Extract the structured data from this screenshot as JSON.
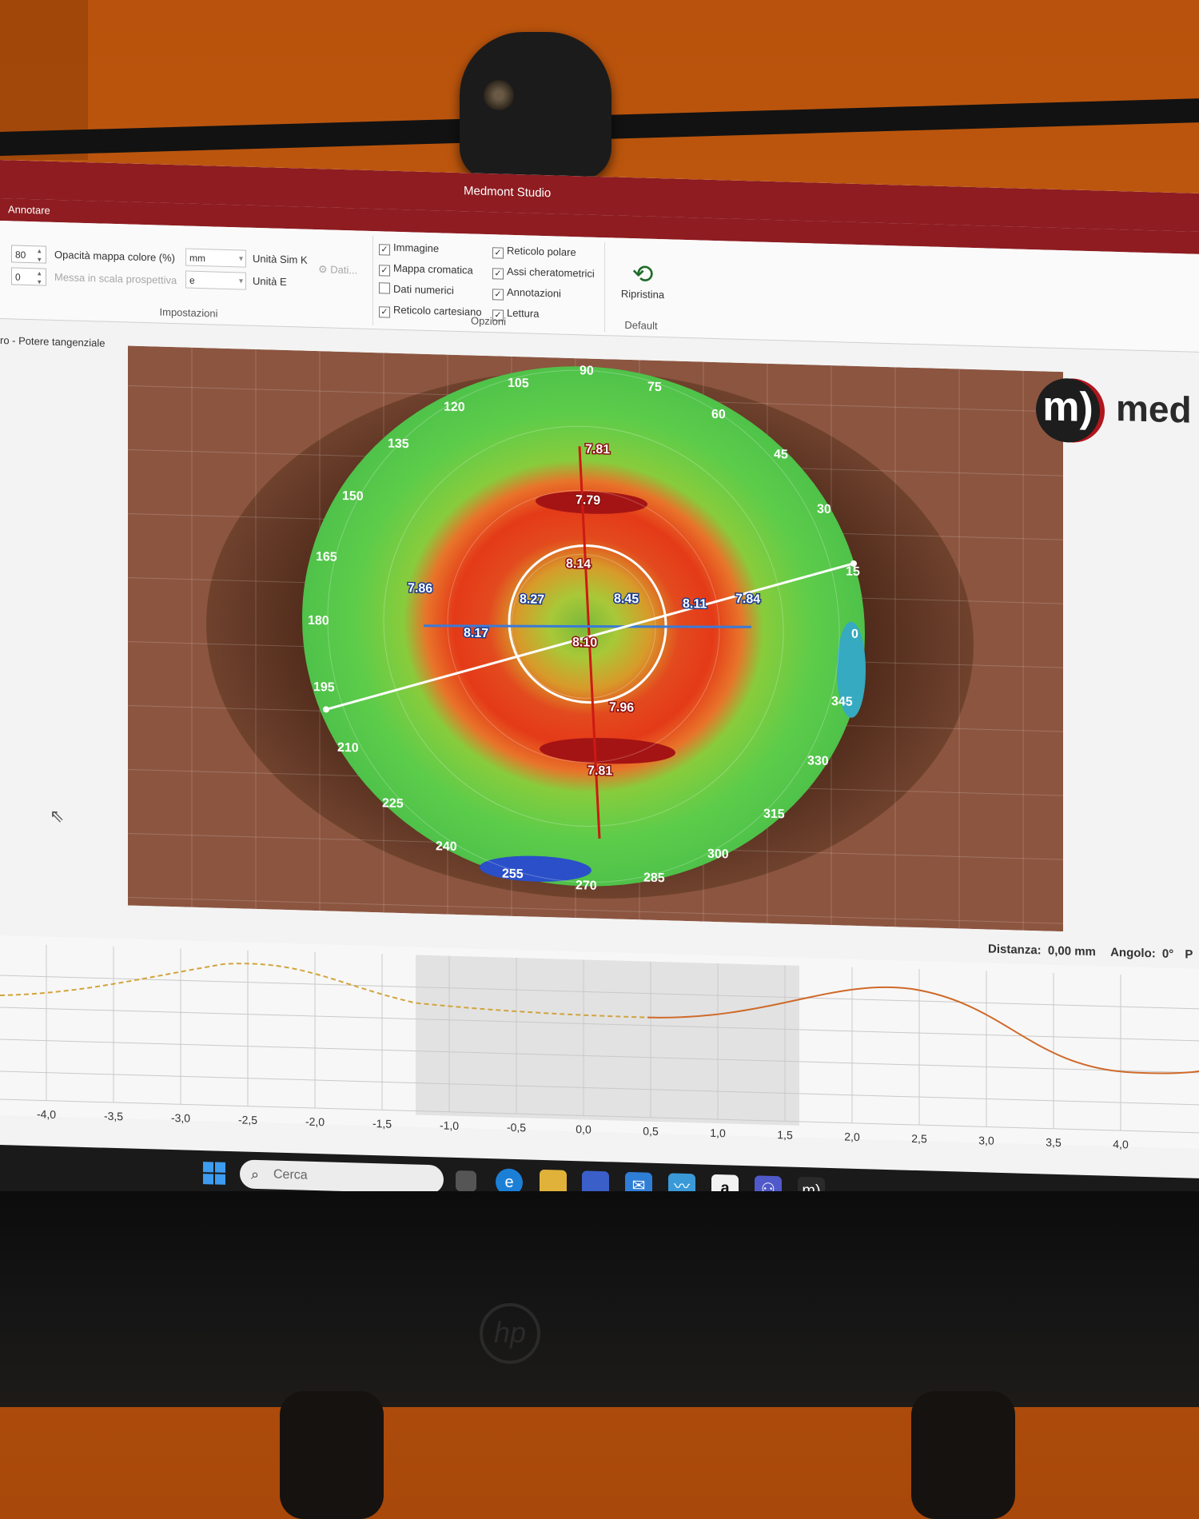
{
  "window": {
    "title": "Medmont Studio"
  },
  "tabs": {
    "annotate": "Annotare"
  },
  "ribbon": {
    "impostazioni": {
      "opacity_value": "80",
      "opacity_label": "Opacità mappa colore (%)",
      "perspective_value": "0",
      "perspective_label": "Messa in scala prospettiva",
      "simk_unit_value": "mm",
      "simk_unit_label": "Unità Sim K",
      "e_unit_value": "e",
      "e_unit_label": "Unità E",
      "data_button": "Dati...",
      "group_label": "Impostazioni"
    },
    "opzioni": {
      "items": [
        {
          "label": "Immagine",
          "checked": true
        },
        {
          "label": "Mappa cromatica",
          "checked": true
        },
        {
          "label": "Dati numerici",
          "checked": false
        },
        {
          "label": "Reticolo cartesiano",
          "checked": true
        },
        {
          "label": "Reticolo polare",
          "checked": true
        },
        {
          "label": "Assi cheratometrici",
          "checked": true
        },
        {
          "label": "Annotazioni",
          "checked": true
        },
        {
          "label": "Lettura",
          "checked": true
        }
      ],
      "group_label": "Opzioni"
    },
    "default": {
      "restore_button": "Ripristina",
      "group_label": "Default"
    }
  },
  "view": {
    "title": "ro - Potere tangenziale"
  },
  "map": {
    "angles": [
      "0",
      "15",
      "30",
      "45",
      "60",
      "75",
      "90",
      "105",
      "120",
      "135",
      "150",
      "165",
      "180",
      "195",
      "210",
      "225",
      "240",
      "255",
      "270",
      "285",
      "300",
      "315",
      "330",
      "345"
    ],
    "readings": [
      "7.81",
      "7.79",
      "8.14",
      "7.86",
      "8.27",
      "8.45",
      "8.11",
      "7.84",
      "8.17",
      "8.10",
      "7.96",
      "7.81"
    ]
  },
  "logo": {
    "mark": "m)",
    "text": "med"
  },
  "profile": {
    "distance_label": "Distanza:",
    "distance_value": "0,00 mm",
    "angle_label": "Angolo:",
    "angle_value": "0°",
    "extra": "P",
    "x_ticks": [
      "-4,0",
      "-3,5",
      "-3,0",
      "-2,5",
      "-2,0",
      "-1,5",
      "-1,0",
      "-0,5",
      "0,0",
      "0,5",
      "1,0",
      "1,5",
      "2,0",
      "2,5",
      "3,0",
      "3,5",
      "4,0"
    ]
  },
  "taskbar": {
    "search_placeholder": "Cerca",
    "amazon_glyph": "a",
    "app_mark": "m)"
  },
  "monitor": {
    "brand": "hp"
  },
  "colors": {
    "titlebar": "#8e1c21",
    "accent_green": "#1f6b2a"
  }
}
